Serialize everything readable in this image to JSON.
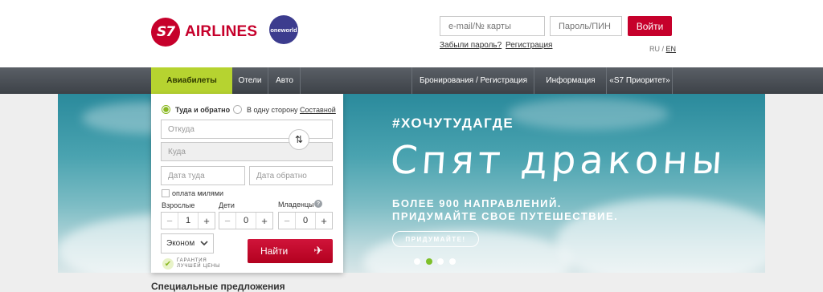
{
  "brand": {
    "logo_mark": "S7",
    "logo_text": "AIRLINES",
    "alliance": "oneworld"
  },
  "login": {
    "email_placeholder": "e-mail/№ карты",
    "password_placeholder": "Пароль/ПИН",
    "submit_label": "Войти",
    "forgot_label": "Забыли пароль?",
    "register_label": "Регистрация"
  },
  "lang": {
    "ru": "RU",
    "sep": " / ",
    "en": "EN"
  },
  "nav": {
    "items": [
      {
        "label": "Авиабилеты",
        "active": true
      },
      {
        "label": "Отели"
      },
      {
        "label": "Авто"
      },
      {
        "label": "Бронирования / Регистрация"
      },
      {
        "label": "Информация"
      },
      {
        "label": "«S7 Приоритет»"
      }
    ]
  },
  "search": {
    "trip_roundtrip": "Туда и обратно",
    "trip_oneway": "В одну сторону",
    "trip_multi": "Составной",
    "from_placeholder": "Откуда",
    "to_placeholder": "Куда",
    "depart_placeholder": "Дата туда",
    "return_placeholder": "Дата обратно",
    "miles_label": "оплата милями",
    "adults_label": "Взрослые",
    "children_label": "Дети",
    "infants_label": "Младенцы",
    "adults_value": "1",
    "children_value": "0",
    "infants_value": "0",
    "help_symbol": "?",
    "class_value": "Эконом",
    "submit_label": "Найти",
    "guarantee_line1": "ГАРАНТИЯ",
    "guarantee_line2": "ЛУЧШЕЙ ЦЕНЫ"
  },
  "banner": {
    "hashtag": "#ХОЧУТУДАГДЕ",
    "headline": "Спят драконы",
    "sub_line1": "БОЛЕЕ 900 НАПРАВЛЕНИЙ.",
    "sub_line2": "ПРИДУМАЙТЕ СВОЕ ПУТЕШЕСТВИЕ.",
    "cta_label": "ПРИДУМАЙТЕ!",
    "active_slide": 2,
    "slide_count": 4
  },
  "offers": {
    "title": "Специальные предложения"
  },
  "colors": {
    "brand_red": "#c6002b",
    "accent_green": "#b6d330",
    "nav_dark": "#45494f"
  }
}
